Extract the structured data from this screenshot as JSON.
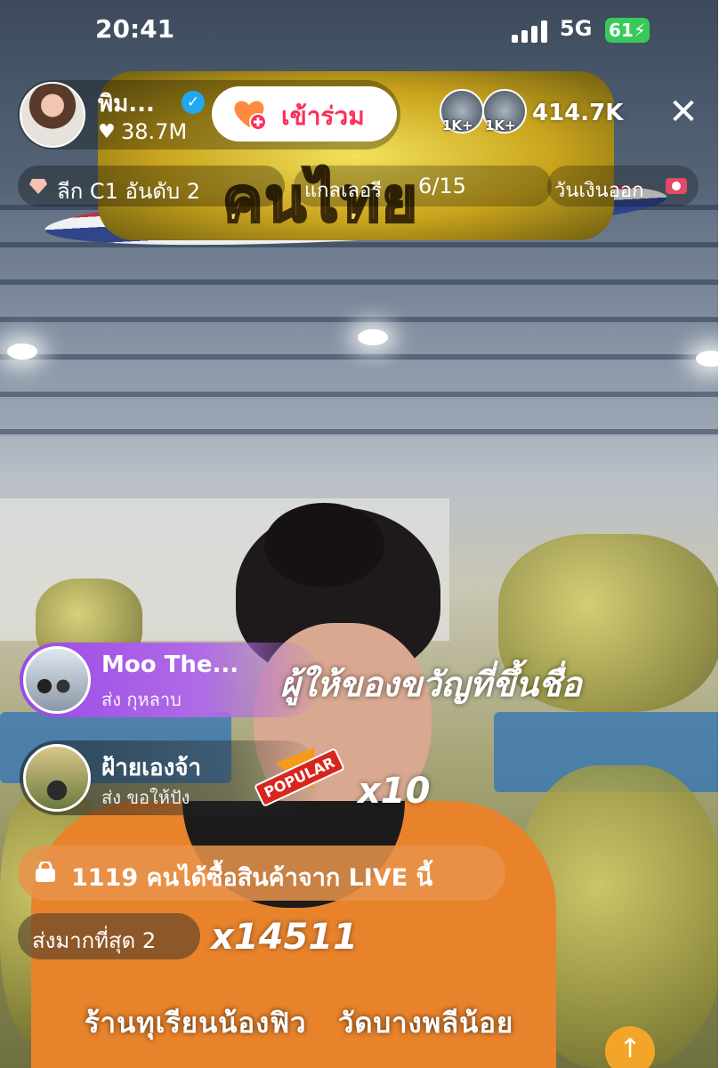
{
  "status_bar": {
    "time": "20:41",
    "network": "5G",
    "battery": "61"
  },
  "host": {
    "name": "พิม...",
    "likes": "38.7M",
    "join_label": "เข้าร่วม"
  },
  "viewers": {
    "badges": [
      "1K+",
      "1K+"
    ],
    "count": "414.7K"
  },
  "info_row": {
    "league": "ลีก C1 อันดับ 2",
    "gallery_label": "แกลเลอรี",
    "gallery_count": "6/15",
    "payday": "วันเงินออก"
  },
  "banner": {
    "text": "คนไทย"
  },
  "gifts": [
    {
      "name": "Moo The...",
      "sub": "ส่ง กุหลาบ"
    },
    {
      "name": "ฝ้ายเองจ้า",
      "sub": "ส่ง ขอให้ปัง"
    }
  ],
  "top_gifter_label": "ผู้ให้ของขวัญที่ขึ้นชื่อ",
  "popular_badge": "POPULAR",
  "combo": "x10",
  "purchase_text": "1119 คนได้ซื้อสินค้าจาก LIVE นี้",
  "most_sent": {
    "label": "ส่งมากที่สุด 2",
    "count": "x14511"
  },
  "caption": "ร้านทุเรียนน้องฟิว   วัดบางพลีน้อย",
  "colors": {
    "join": "#ff2d5a",
    "verified": "#21a8f0",
    "battery": "#37c95a",
    "gift_purple": "#9b49e8",
    "purchase": "#e8934b"
  }
}
